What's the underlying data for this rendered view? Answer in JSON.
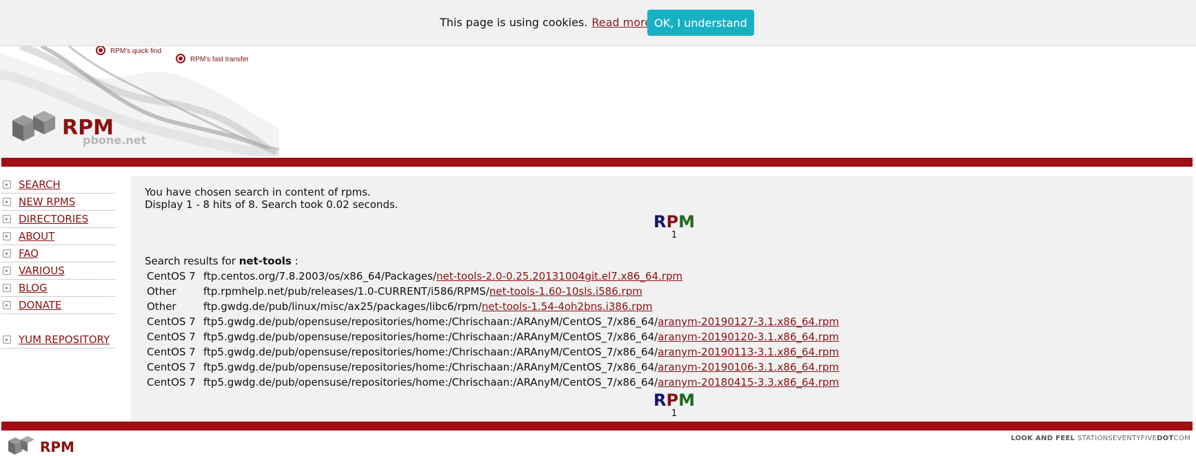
{
  "cookie_bar": {
    "text": "This page is using cookies.",
    "link": "Read more",
    "button": "OK, I understand"
  },
  "header": {
    "logo_text": "RPM",
    "logo_subtext": "pbone.net",
    "tagline_1": "RPM's quick find",
    "tagline_2": "RPM's fast transfer"
  },
  "sidebar": {
    "items": [
      {
        "label": "SEARCH"
      },
      {
        "label": "NEW RPMS"
      },
      {
        "label": "DIRECTORIES"
      },
      {
        "label": "ABOUT"
      },
      {
        "label": "FAQ"
      },
      {
        "label": "VARIOUS"
      },
      {
        "label": "BLOG"
      },
      {
        "label": "DONATE"
      }
    ],
    "extra_item": {
      "label": "YUM REPOSITORY"
    }
  },
  "main": {
    "intro_line_1": "You have chosen search in content of rpms.",
    "intro_line_2": "Display 1 - 8 hits of 8. Search took 0.02 seconds.",
    "pager_top": {
      "letters": [
        "R",
        "P",
        "M"
      ],
      "page": "1"
    },
    "pager_bottom": {
      "letters": [
        "R",
        "P",
        "M"
      ],
      "page": "1"
    },
    "results_prefix": "Search results for",
    "query": "net-tools",
    "results_suffix": ":",
    "results": [
      {
        "dist": "CentOS 7",
        "path": "ftp.centos.org/7.8.2003/os/x86_64/Packages/",
        "pkg": "net-tools-2.0-0.25.20131004git.el7.x86_64.rpm"
      },
      {
        "dist": "Other",
        "path": "ftp.rpmhelp.net/pub/releases/1.0-CURRENT/i586/RPMS/",
        "pkg": "net-tools-1.60-10sls.i586.rpm"
      },
      {
        "dist": "Other",
        "path": "ftp.gwdg.de/pub/linux/misc/ax25/packages/libc6/rpm/",
        "pkg": "net-tools-1.54-4oh2bns.i386.rpm"
      },
      {
        "dist": "CentOS 7",
        "path": "ftp5.gwdg.de/pub/opensuse/repositories/home:/Chrischaan:/ARAnyM/CentOS_7/x86_64/",
        "pkg": "aranym-20190127-3.1.x86_64.rpm"
      },
      {
        "dist": "CentOS 7",
        "path": "ftp5.gwdg.de/pub/opensuse/repositories/home:/Chrischaan:/ARAnyM/CentOS_7/x86_64/",
        "pkg": "aranym-20190120-3.1.x86_64.rpm"
      },
      {
        "dist": "CentOS 7",
        "path": "ftp5.gwdg.de/pub/opensuse/repositories/home:/Chrischaan:/ARAnyM/CentOS_7/x86_64/",
        "pkg": "aranym-20190113-3.1.x86_64.rpm"
      },
      {
        "dist": "CentOS 7",
        "path": "ftp5.gwdg.de/pub/opensuse/repositories/home:/Chrischaan:/ARAnyM/CentOS_7/x86_64/",
        "pkg": "aranym-20190106-3.1.x86_64.rpm"
      },
      {
        "dist": "CentOS 7",
        "path": "ftp5.gwdg.de/pub/opensuse/repositories/home:/Chrischaan:/ARAnyM/CentOS_7/x86_64/",
        "pkg": "aranym-20180415-3.3.x86_64.rpm"
      }
    ]
  },
  "footer": {
    "logo_text": "RPM",
    "credit_bold_1": "LOOK AND FEEL",
    "credit_light": "STATIONSEVENTYFIVE",
    "credit_bold_2": "DOT",
    "credit_light_2": "COM"
  },
  "colors": {
    "brand_red": "#a00f14",
    "link_red": "#8b1010",
    "cookie_button": "#18b1c4",
    "panel_bg": "#f1f1f1"
  }
}
